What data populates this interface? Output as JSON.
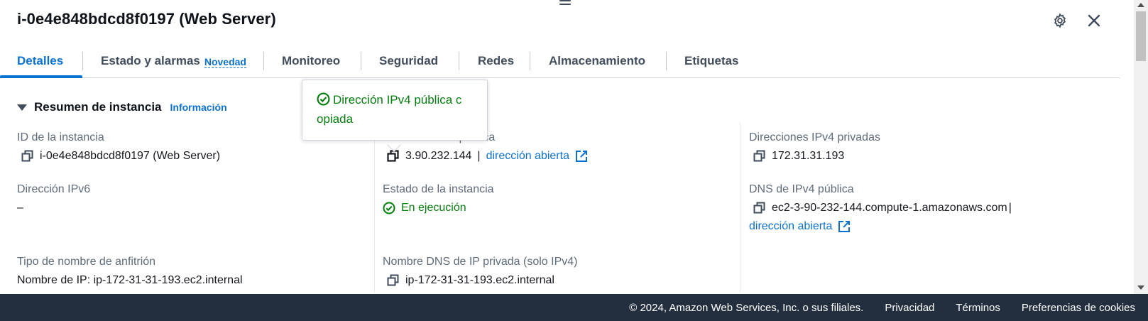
{
  "header": {
    "title": "i-0e4e848bdcd8f0197 (Web Server)",
    "settings_icon": "gear-icon",
    "close_icon": "close-icon"
  },
  "tabs": [
    {
      "label": "Detalles",
      "active": true
    },
    {
      "label": "Estado y alarmas",
      "badge": "Novedad"
    },
    {
      "label": "Monitoreo"
    },
    {
      "label": "Seguridad"
    },
    {
      "label": "Redes"
    },
    {
      "label": "Almacenamiento"
    },
    {
      "label": "Etiquetas"
    }
  ],
  "section": {
    "title": "Resumen de instancia",
    "info_link": "Información"
  },
  "popover": {
    "message_line1": "Dirección IPv4 pública c",
    "message_line2": "opiada"
  },
  "fields": {
    "instance_id": {
      "label": "ID de la instancia",
      "value": "i-0e4e848bdcd8f0197 (Web Server)"
    },
    "public_ipv4": {
      "label": "Dirección IPv4 pública",
      "value": "3.90.232.144",
      "link": "dirección abierta"
    },
    "private_ipv4": {
      "label": "Direcciones IPv4 privadas",
      "value": "172.31.31.193"
    },
    "ipv6": {
      "label": "Dirección IPv6",
      "value": "–"
    },
    "instance_state": {
      "label": "Estado de la instancia",
      "value": "En ejecución"
    },
    "public_dns": {
      "label": "DNS de IPv4 pública",
      "value": "ec2-3-90-232-144.compute-1.amazonaws.com",
      "link": "dirección abierta"
    },
    "hostname_type": {
      "label": "Tipo de nombre de anfitrión",
      "value": "Nombre de IP: ip-172-31-31-193.ec2.internal"
    },
    "private_dns": {
      "label": "Nombre DNS de IP privada (solo IPv4)",
      "value": "ip-172-31-31-193.ec2.internal"
    }
  },
  "footer": {
    "copyright": "© 2024, Amazon Web Services, Inc. o sus filiales.",
    "privacy": "Privacidad",
    "terms": "Términos",
    "cookies": "Preferencias de cookies"
  },
  "colors": {
    "accent": "#0972d3",
    "success": "#037f0c",
    "footer_bg": "#232f3e"
  }
}
